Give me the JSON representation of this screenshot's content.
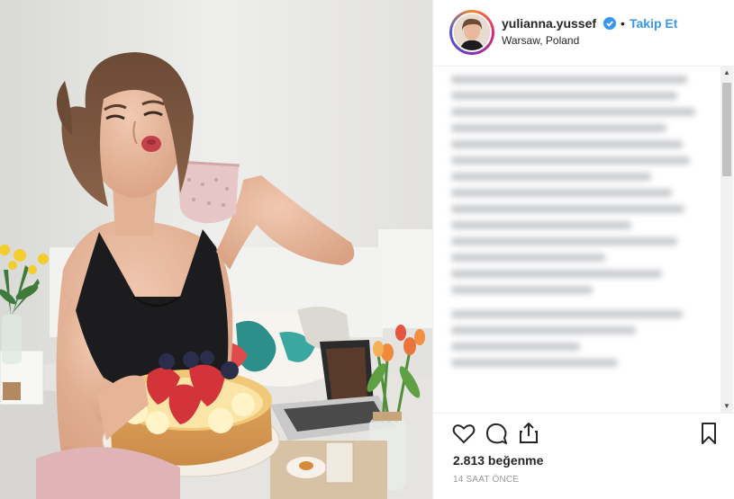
{
  "post": {
    "username": "yulianna.yussef",
    "separator": "•",
    "follow_label": "Takip Et",
    "location": "Warsaw, Poland",
    "likes": "2.813 beğenme",
    "timestamp": "14 SAAT ÖNCE"
  },
  "icons": {
    "verified": "verified-badge-icon",
    "like": "heart-icon",
    "comment": "comment-icon",
    "share": "share-icon",
    "save": "bookmark-icon"
  },
  "colors": {
    "accent": "#3897f0",
    "text": "#262626",
    "muted": "#999999"
  }
}
